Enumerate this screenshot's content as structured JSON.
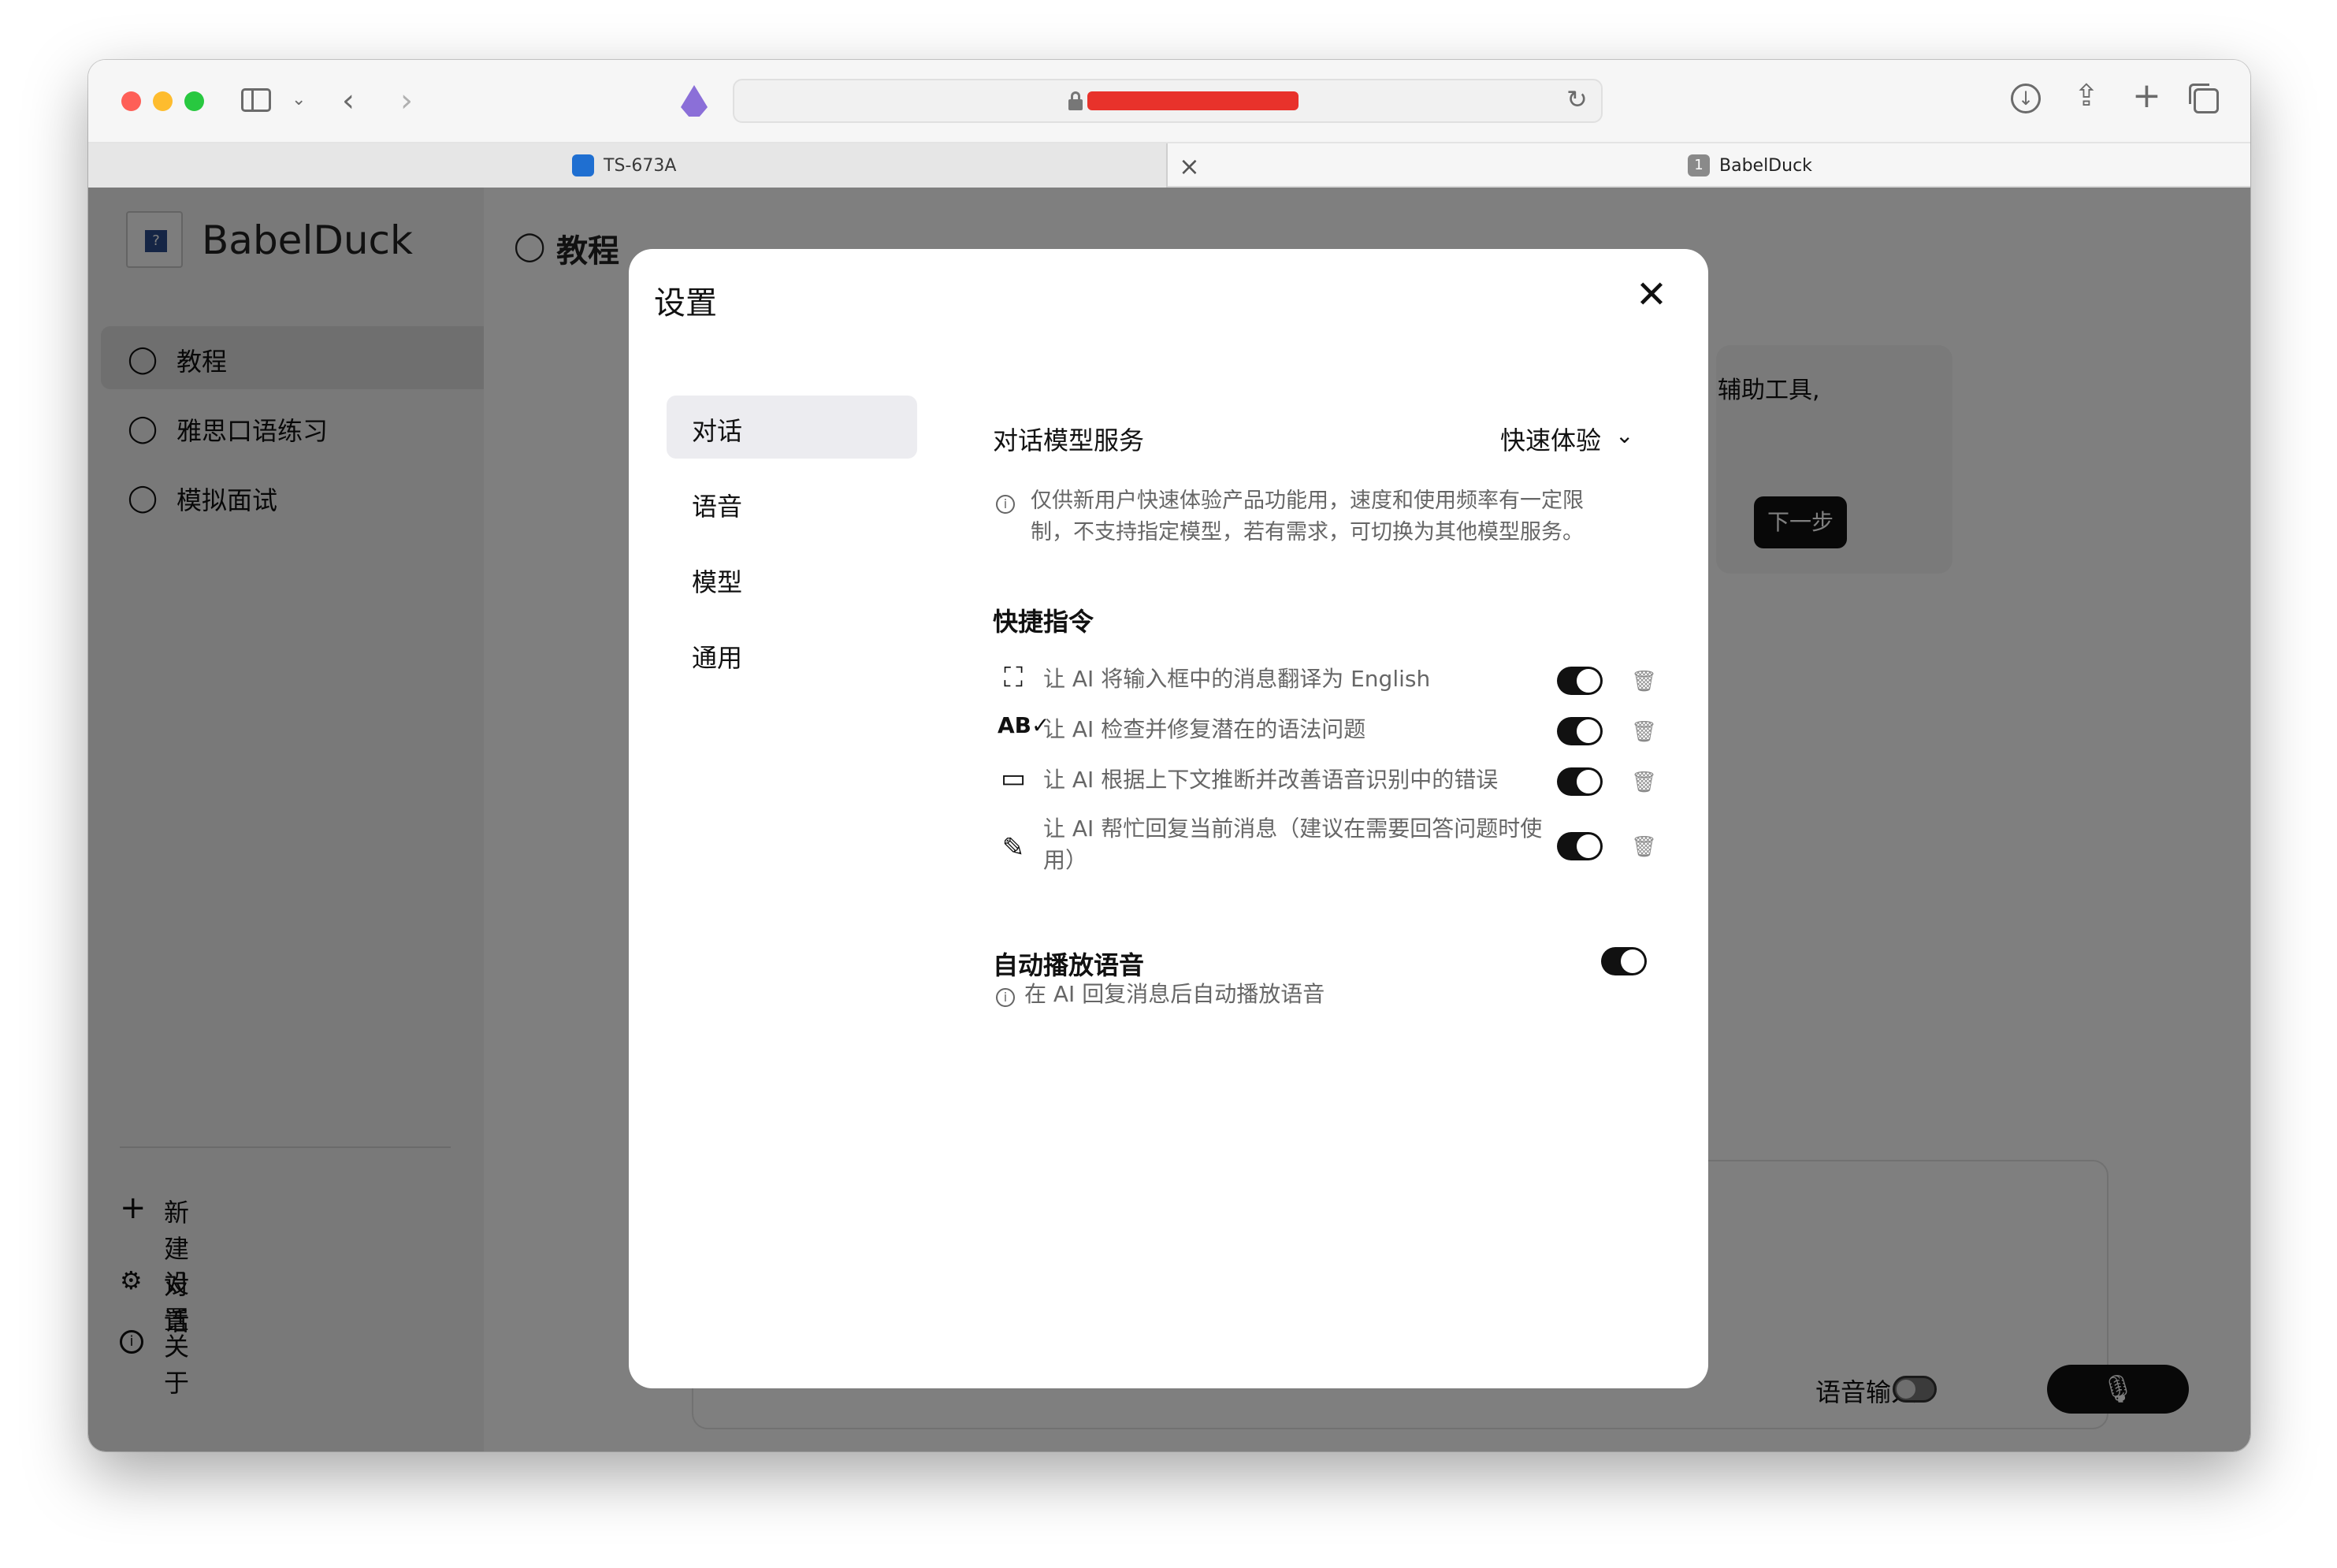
{
  "browser": {
    "tab_left_title": "TS-673A",
    "tab_right_title": "BabelDuck",
    "tab_right_badge": "1",
    "tab_close": "×"
  },
  "sidebar": {
    "brand": "BabelDuck",
    "logo_glyph": "?",
    "items": [
      {
        "label": "教程",
        "icon": "chat-bubble-icon",
        "active": true
      },
      {
        "label": "雅思口语练习",
        "icon": "chat-bubble-icon",
        "active": false
      },
      {
        "label": "模拟面试",
        "icon": "chat-bubble-icon",
        "active": false
      }
    ],
    "footer": [
      {
        "label": "新建对话",
        "icon": "plus-icon"
      },
      {
        "label": "设置",
        "icon": "gear-icon"
      },
      {
        "label": "关于",
        "icon": "info-icon"
      }
    ]
  },
  "main": {
    "title": "教程",
    "bubble_text": "辅助工具,",
    "next_button": "下一步",
    "voice_input_label": "语音输入"
  },
  "modal": {
    "title": "设置",
    "nav": [
      {
        "label": "对话",
        "active": true
      },
      {
        "label": "语音",
        "active": false
      },
      {
        "label": "模型",
        "active": false
      },
      {
        "label": "通用",
        "active": false
      }
    ],
    "model_service": {
      "label": "对话模型服务",
      "value": "快速体验",
      "note_line1": "仅供新用户快速体验产品功能用，速度和使用频率有一定限",
      "note_line2": "制，不支持指定模型，若有需求，可切换为其他模型服务。"
    },
    "shortcuts": {
      "title": "快捷指令",
      "items": [
        {
          "text": "让 AI 将输入框中的消息翻译为 English",
          "icon": "translate-icon",
          "enabled": true
        },
        {
          "text": "让 AI 检查并修复潜在的语法问题",
          "icon": "spellcheck-icon",
          "enabled": true
        },
        {
          "text": "让 AI 根据上下文推断并改善语音识别中的错误",
          "icon": "voice-chat-icon",
          "enabled": true
        },
        {
          "text": "让 AI 帮忙回复当前消息（建议在需要回答问题时使用）",
          "icon": "pencil-icon",
          "enabled": true
        }
      ]
    },
    "autoplay": {
      "title": "自动播放语音",
      "note": "在 AI 回复消息后自动播放语音",
      "enabled": true
    }
  }
}
